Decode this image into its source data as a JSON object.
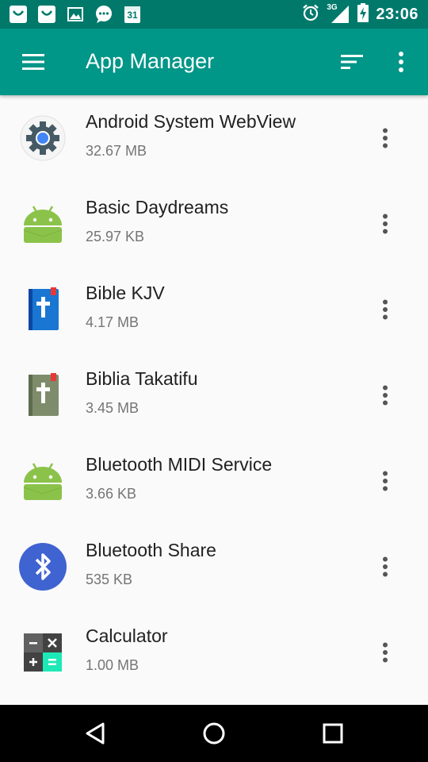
{
  "status_bar": {
    "time": "23:06",
    "network": "3G",
    "notification_icons": [
      "app-notification-icon",
      "app-notification-icon",
      "image-icon",
      "chat-icon",
      "calendar-icon"
    ],
    "calendar_day": "31"
  },
  "toolbar": {
    "title": "App Manager",
    "menu_icon": "hamburger-menu-icon",
    "sort_icon": "sort-icon",
    "more_icon": "more-vert-icon"
  },
  "apps": [
    {
      "name": "Android System WebView",
      "size": "32.67 MB",
      "icon": "webview-gear-icon"
    },
    {
      "name": "Basic Daydreams",
      "size": "25.97 KB",
      "icon": "android-icon"
    },
    {
      "name": "Bible KJV",
      "size": "4.17 MB",
      "icon": "bible-kjv-icon"
    },
    {
      "name": "Biblia Takatifu",
      "size": "3.45 MB",
      "icon": "bible-takatifu-icon"
    },
    {
      "name": "Bluetooth MIDI Service",
      "size": "3.66 KB",
      "icon": "android-icon"
    },
    {
      "name": "Bluetooth Share",
      "size": "535 KB",
      "icon": "bluetooth-icon"
    },
    {
      "name": "Calculator",
      "size": "1.00 MB",
      "icon": "calculator-icon"
    }
  ],
  "colors": {
    "primary": "#009688",
    "primary_dark": "#00796B",
    "android_green": "#8BC34A",
    "bluetooth_blue": "#3F63D0"
  }
}
